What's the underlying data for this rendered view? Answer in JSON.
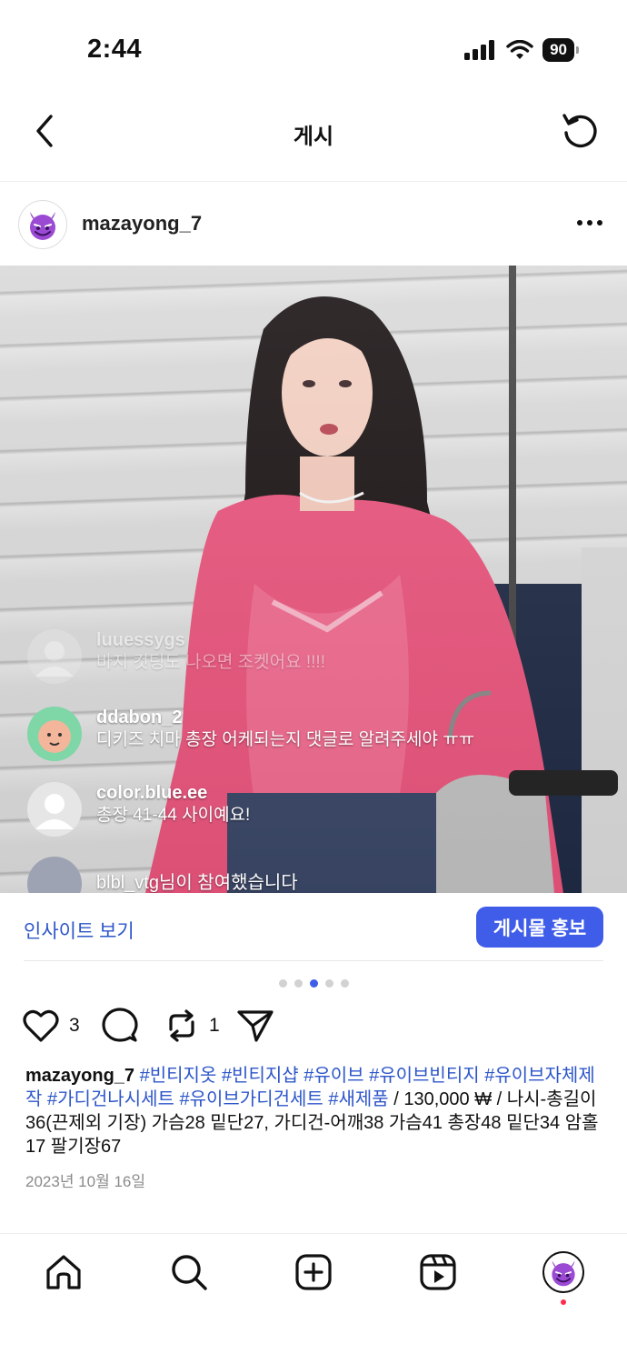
{
  "status": {
    "time": "2:44",
    "battery": "90"
  },
  "nav": {
    "title": "게시"
  },
  "post": {
    "username": "mazayong_7",
    "comments": [
      {
        "user": "luuessygs",
        "text": "바지 컷팅도 나오면 조켓어요 !!!!"
      },
      {
        "user": "ddabon_2",
        "text": "디키즈 치마 총장 어케되는지 댓글로 알려주세야 ㅠㅠ"
      },
      {
        "user": "color.blue.ee",
        "text": "총장 41-44 사이예요!"
      },
      {
        "user": "",
        "text": "blbl_vtg님이 참여했습니다"
      }
    ]
  },
  "insights": {
    "link": "인사이트 보기",
    "promote": "게시물 홍보"
  },
  "carousel": {
    "count": 5,
    "active": 2
  },
  "actions": {
    "likes": "3",
    "reposts": "1"
  },
  "caption": {
    "username": "mazayong_7",
    "tags": [
      "#빈티지옷",
      "#빈티지샵",
      "#유이브",
      "#유이브빈티지",
      "#유이브자체제작",
      "#가디건나시세트",
      "#유이브가디건세트",
      "#새제품"
    ],
    "text": "/ 130,000 ₩ / 나시-총길이36(끈제외 기장) 가슴28 밑단27, 가디건-어깨38 가슴41 총장48 밑단34 암홀17 팔기장67",
    "date": "2023년 10월 16일"
  },
  "colors": {
    "accent": "#3f5de9",
    "link": "#2d56c9",
    "notification": "#ff2b4f"
  },
  "icons": [
    "back-icon",
    "refresh-icon",
    "more-icon",
    "heart-icon",
    "comment-icon",
    "repost-icon",
    "share-icon",
    "home-icon",
    "search-icon",
    "create-icon",
    "reels-icon",
    "profile-avatar"
  ]
}
